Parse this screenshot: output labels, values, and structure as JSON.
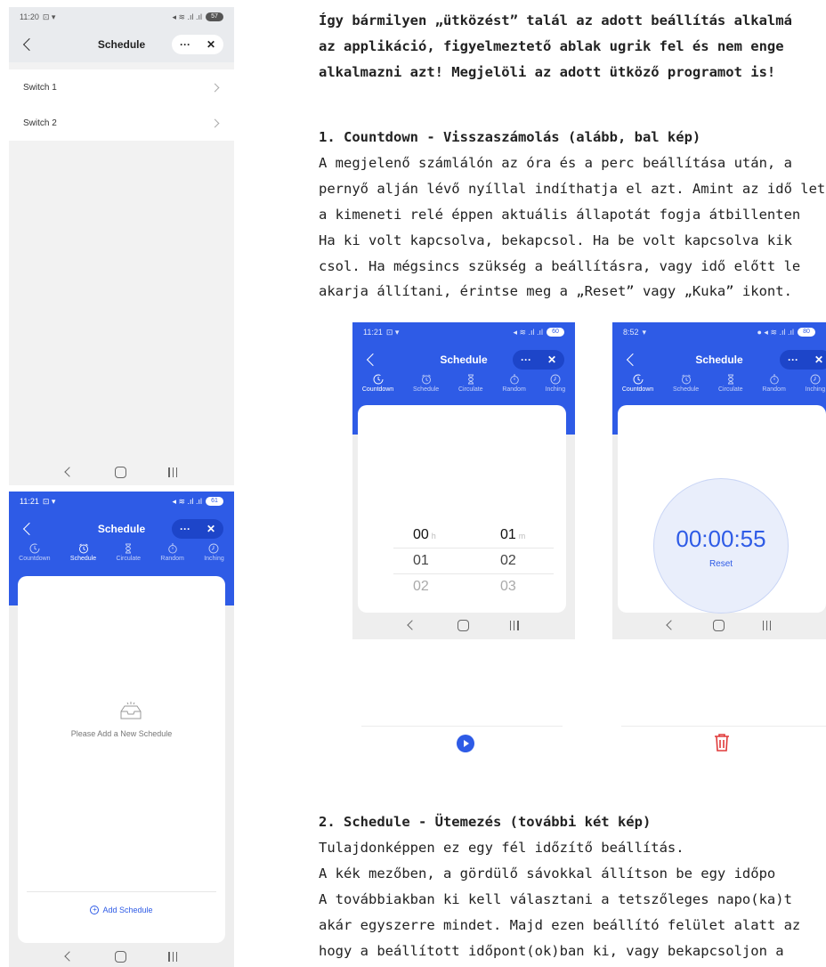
{
  "phone1": {
    "status_time": "11:20",
    "status_battery": "57",
    "title": "Schedule",
    "capsule_more": "···",
    "capsule_close": "✕",
    "switches": [
      "Switch 1",
      "Switch 2"
    ]
  },
  "phone2": {
    "status_time": "11:21",
    "status_battery": "61",
    "title": "Schedule",
    "capsule_more": "···",
    "capsule_close": "✕",
    "modes": [
      "Countdown",
      "Schedule",
      "Circulate",
      "Random",
      "Inching"
    ],
    "active_mode": "Schedule",
    "empty_text": "Please Add a New Schedule",
    "add_label": "Add Schedule"
  },
  "phone3": {
    "status_time": "11:21",
    "status_battery": "60",
    "title": "Schedule",
    "capsule_more": "···",
    "capsule_close": "✕",
    "modes": [
      "Countdown",
      "Schedule",
      "Circulate",
      "Random",
      "Inching"
    ],
    "active_mode": "Countdown",
    "hour_unit": "h",
    "minute_unit": "m",
    "hours": [
      "00",
      "01",
      "02"
    ],
    "minutes": [
      "01",
      "02",
      "03"
    ]
  },
  "phone4": {
    "status_time": "8:52",
    "status_battery": "80",
    "title": "Schedule",
    "capsule_more": "···",
    "capsule_close": "✕",
    "modes": [
      "Countdown",
      "Schedule",
      "Circulate",
      "Random",
      "Inching"
    ],
    "active_mode": "Countdown",
    "timer": "00:00:55",
    "reset_label": "Reset"
  },
  "article": {
    "top_lines": [
      "Így bármilyen „ütközést” talál az adott beállítás alkalmá",
      "az applikáció, figyelmeztető ablak ugrik fel és nem enge",
      "alkalmazni azt! Megjelöli az adott ütköző programot is!"
    ],
    "section1_heading": "1. Countdown - Visszaszámolás (alább, bal kép)",
    "section1_lines": [
      "A megjelenő számlálón az óra és a perc beállítása után, a",
      "pernyő alján lévő nyíllal indíthatja el azt. Amint az idő let",
      "a kimeneti relé éppen aktuális állapotát fogja átbillenten",
      "Ha ki volt kapcsolva, bekapcsol. Ha be volt kapcsolva kik",
      "csol. Ha mégsincs szükség a beállításra, vagy idő előtt le",
      "akarja állítani, érintse meg a „Reset” vagy „Kuka” ikont."
    ],
    "section2_heading": "2. Schedule - Ütemezés (további két kép)",
    "section2_lines": [
      "Tulajdonképpen ez egy fél időzítő beállítás.",
      "A kék mezőben, a gördülő sávokkal állítson be egy időpo",
      "A továbbiakban ki kell választani a tetszőleges napo(ka)t",
      "akár egyszerre mindet. Majd ezen beállító felület alatt az",
      "hogy a beállított időpont(ok)ban ki, vagy bekapcsoljon a"
    ]
  },
  "colors": {
    "accent": "#2e5be6",
    "accent_dark": "#1d45c9",
    "trash": "#e03a3a"
  },
  "icons": [
    "back-chevron-icon",
    "more-icon",
    "close-icon",
    "countdown-icon",
    "alarm-icon",
    "hourglass-icon",
    "stopwatch-icon",
    "inching-icon",
    "empty-tray-icon",
    "add-circle-icon",
    "play-icon",
    "trash-icon"
  ]
}
